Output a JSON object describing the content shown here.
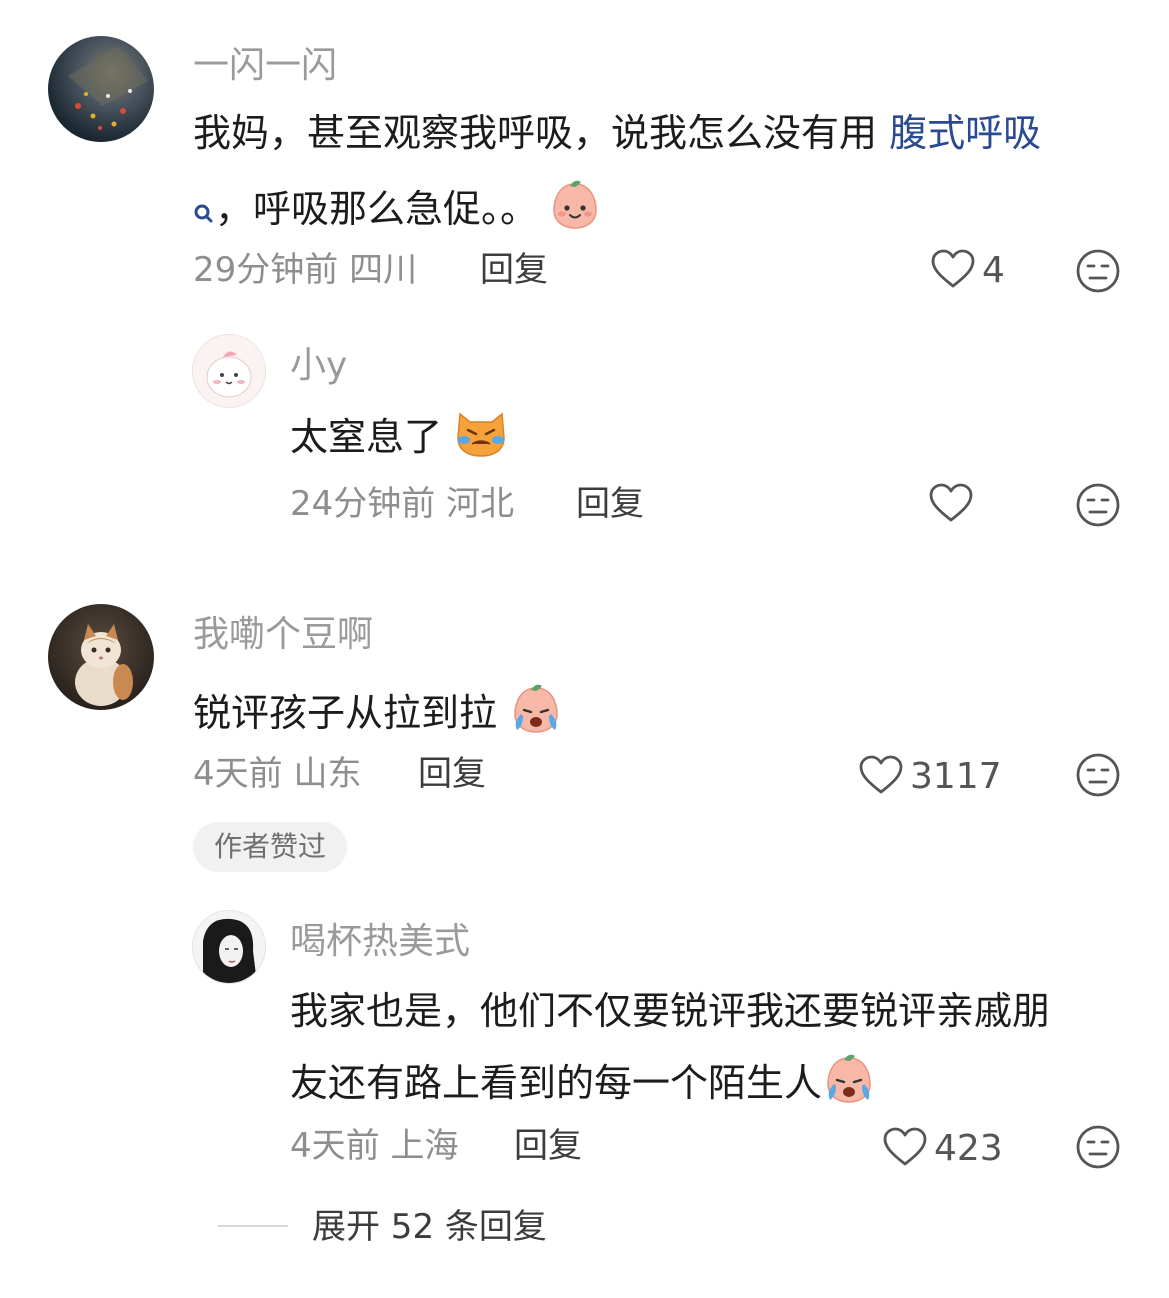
{
  "comments": [
    {
      "username": "一闪一闪",
      "text_part1": "我妈，甚至观察我呼吸，说我怎么没有用 ",
      "link_text": "腹式呼吸",
      "text_part2": "，呼吸那么急促。。",
      "time": "29分钟前",
      "location": "四川",
      "reply_label": "回复",
      "likes": "4",
      "replies": [
        {
          "username": "小y",
          "text": "太窒息了",
          "time": "24分钟前",
          "location": "河北",
          "reply_label": "回复",
          "likes": ""
        }
      ]
    },
    {
      "username": "我嘞个豆啊",
      "text": "锐评孩子从拉到拉",
      "time": "4天前",
      "location": "山东",
      "reply_label": "回复",
      "likes": "3117",
      "badge": "作者赞过",
      "replies": [
        {
          "username": "喝杯热美式",
          "text_line1": "我家也是，他们不仅要锐评我还要锐评亲戚朋",
          "text_line2": "友还有路上看到的每一个陌生人",
          "time": "4天前",
          "location": "上海",
          "reply_label": "回复",
          "likes": "423"
        }
      ],
      "expand_label": "展开 52 条回复"
    }
  ],
  "colors": {
    "link": "#2a4a92",
    "username": "#9a9a9a",
    "meta": "#8e8e8e"
  }
}
